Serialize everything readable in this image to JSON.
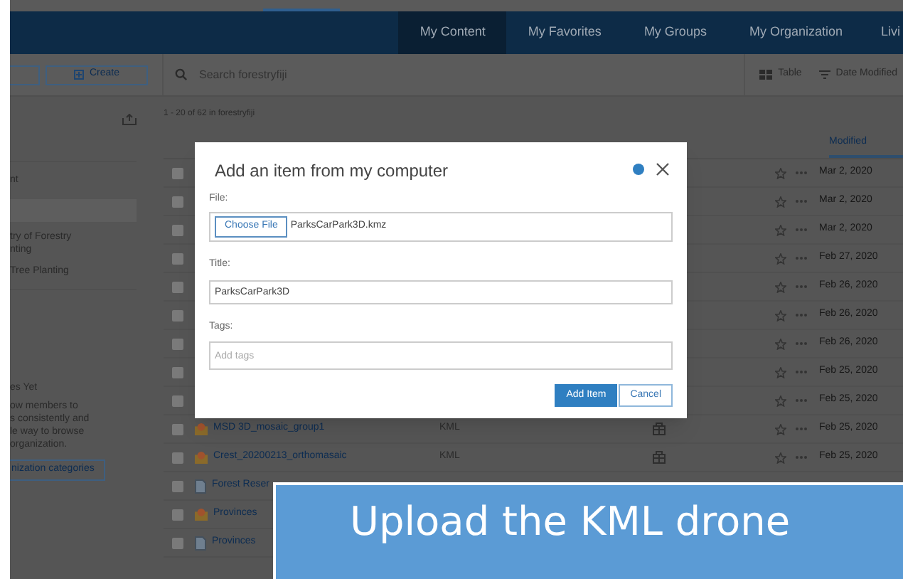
{
  "nav": {
    "items": [
      {
        "label": "My Content",
        "selected": true
      },
      {
        "label": "My Favorites",
        "selected": false
      },
      {
        "label": "My Groups",
        "selected": false
      },
      {
        "label": "My Organization",
        "selected": false
      },
      {
        "label": "Livi",
        "selected": false
      }
    ]
  },
  "toolbar": {
    "create_button": "Create",
    "search": {
      "placeholder": "Search forestryfiji"
    },
    "view_button": "Table",
    "sort_button": "Date Modified"
  },
  "sidebar": {
    "items": [
      "nt",
      "try of Forestry",
      "nting",
      "Tree Planting"
    ],
    "empty_title": "es Yet",
    "empty_text": [
      "ow members to",
      "s consistently and",
      "le way to browse",
      "organization."
    ],
    "categories_button": "nization categories"
  },
  "results": {
    "count": "1 - 20 of 62 in forestryfiji"
  },
  "table": {
    "column_header": "Modified",
    "rows": [
      {
        "checked": false,
        "date": "Mar 2, 2020"
      },
      {
        "checked": false,
        "date": "Mar 2, 2020"
      },
      {
        "checked": false,
        "date": "Mar 2, 2020"
      },
      {
        "checked": false,
        "date": "Feb 27, 2020"
      },
      {
        "checked": false,
        "date": "Feb 26, 2020"
      },
      {
        "checked": false,
        "date": "Feb 26, 2020"
      },
      {
        "checked": false,
        "date": "Feb 26, 2020"
      },
      {
        "checked": false,
        "date": "Feb 25, 2020"
      },
      {
        "checked": false,
        "date": "Feb 25, 2020"
      },
      {
        "checked": false,
        "kind": "kml",
        "name": "MSD 3D_mosaic_group1",
        "type": "KML",
        "shared": true,
        "date": "Feb 25, 2020"
      },
      {
        "checked": false,
        "kind": "kml",
        "name": "Crest_20200213_orthomasaic",
        "type": "KML",
        "shared": true,
        "date": "Feb 25, 2020"
      },
      {
        "checked": false,
        "kind": "doc",
        "name": "Forest Reser"
      },
      {
        "checked": false,
        "kind": "kml",
        "name": "Provinces"
      },
      {
        "checked": false,
        "kind": "doc",
        "name": "Provinces"
      }
    ]
  },
  "dialog": {
    "title": "Add an item from my computer",
    "file_label": "File:",
    "choose_button": "Choose File",
    "file_name": "ParksCarPark3D.kmz",
    "title_label": "Title:",
    "title_value": "ParksCarPark3D",
    "tags_label": "Tags:",
    "tags_placeholder": "Add tags",
    "add_button": "Add Item",
    "cancel_button": "Cancel"
  },
  "caption": "Upload the KML drone"
}
